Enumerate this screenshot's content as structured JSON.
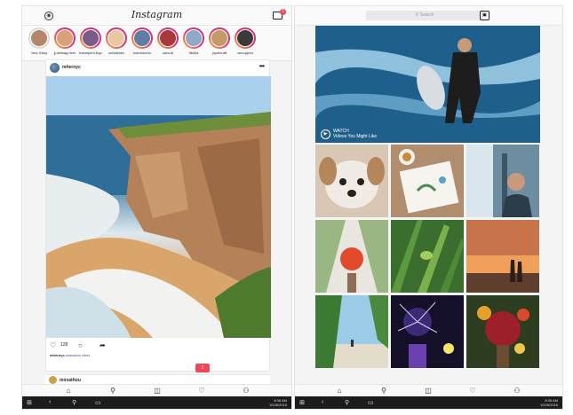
{
  "left": {
    "header": {
      "logo": "Instagram",
      "inbox_badge": "1"
    },
    "stories": [
      {
        "name": "Your Story",
        "ring": false
      },
      {
        "name": "jj.delwag.river",
        "ring": true
      },
      {
        "name": "travelprint.frgo",
        "ring": true
      },
      {
        "name": "schiderart",
        "ring": true
      },
      {
        "name": "barclonerio",
        "ring": true
      },
      {
        "name": "sara.dl",
        "ring": true
      },
      {
        "name": "dbolla",
        "ring": true
      },
      {
        "name": "joyofcraft",
        "ring": true
      },
      {
        "name": "wrcopped",
        "ring": true
      }
    ],
    "post": {
      "username": "mhernyc",
      "more": "•••",
      "likes": "128",
      "caption_user": "mhernyc",
      "caption_tag": "#vacation vibes"
    },
    "post2": {
      "username": "mirzathou"
    },
    "notification": "1"
  },
  "right": {
    "search": {
      "placeholder": "Search"
    },
    "hero": {
      "watch": "WATCH",
      "title": "Videos You Might Like"
    }
  },
  "taskbar": {
    "time": "8:36 AM",
    "date": "10/26/2016"
  },
  "colors": {
    "accent": "#ed4956",
    "link": "#385185"
  }
}
